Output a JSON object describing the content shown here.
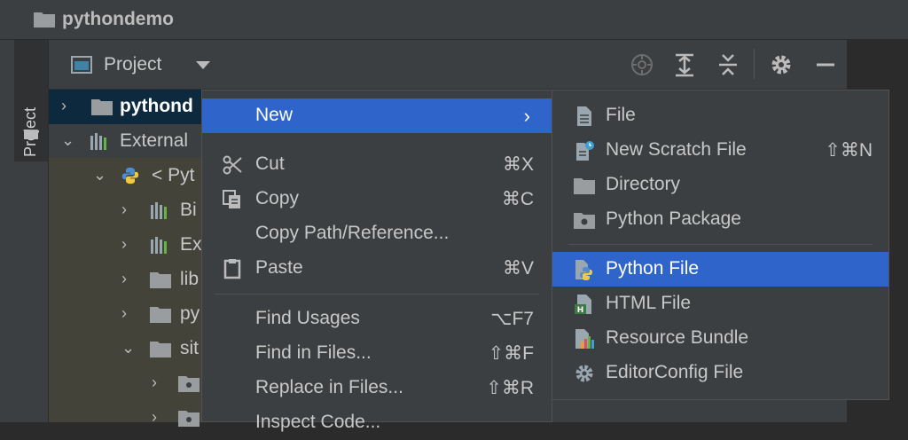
{
  "window": {
    "title": "pythondemo"
  },
  "tool_strip": {
    "tab_label": "Project"
  },
  "project_panel": {
    "view_label": "Project",
    "toolbar_icons": [
      "locate-icon",
      "expand-all-icon",
      "collapse-all-icon",
      "gear-icon",
      "minimize-icon"
    ]
  },
  "tree": {
    "rows": [
      {
        "label": "pythond",
        "arrow": "›",
        "icon": "folder-icon",
        "selected": true,
        "bold": true
      },
      {
        "label": "External",
        "arrow": "⌄",
        "icon": "library-icon"
      },
      {
        "label": "< Pyt",
        "arrow": "⌄",
        "icon": "python-icon"
      },
      {
        "label": "Bi",
        "arrow": "›",
        "icon": "library-icon"
      },
      {
        "label": "Ex",
        "arrow": "›",
        "icon": "library-icon"
      },
      {
        "label": "lib",
        "arrow": "›",
        "icon": "folder-icon"
      },
      {
        "label": "py",
        "arrow": "›",
        "icon": "folder-icon"
      },
      {
        "label": "sit",
        "arrow": "⌄",
        "icon": "folder-icon"
      },
      {
        "label": "",
        "arrow": "›",
        "icon": "package-icon"
      },
      {
        "label": "",
        "arrow": "›",
        "icon": "package-icon"
      }
    ]
  },
  "context_menu": {
    "items": [
      {
        "label": "New",
        "shortcut": "",
        "submenu": "›",
        "icon": "",
        "active": true
      },
      {
        "label": "Cut",
        "shortcut": "⌘X",
        "icon": "scissors-icon"
      },
      {
        "label": "Copy",
        "shortcut": "⌘C",
        "icon": "copy-icon"
      },
      {
        "label": "Copy Path/Reference...",
        "shortcut": "",
        "icon": ""
      },
      {
        "label": "Paste",
        "shortcut": "⌘V",
        "icon": "clipboard-icon"
      },
      {
        "label": "Find Usages",
        "shortcut": "⌥F7",
        "icon": ""
      },
      {
        "label": "Find in Files...",
        "shortcut": "⇧⌘F",
        "icon": ""
      },
      {
        "label": "Replace in Files...",
        "shortcut": "⇧⌘R",
        "icon": ""
      },
      {
        "label": "Inspect Code...",
        "shortcut": "",
        "icon": ""
      }
    ]
  },
  "new_submenu": {
    "items": [
      {
        "label": "File",
        "shortcut": "",
        "icon": "file-icon"
      },
      {
        "label": "New Scratch File",
        "shortcut": "⇧⌘N",
        "icon": "scratch-file-icon"
      },
      {
        "label": "Directory",
        "shortcut": "",
        "icon": "folder-icon"
      },
      {
        "label": "Python Package",
        "shortcut": "",
        "icon": "package-icon"
      },
      {
        "label": "Python File",
        "shortcut": "",
        "icon": "python-file-icon",
        "active": true
      },
      {
        "label": "HTML File",
        "shortcut": "",
        "icon": "html-file-icon"
      },
      {
        "label": "Resource Bundle",
        "shortcut": "",
        "icon": "resource-bundle-icon"
      },
      {
        "label": "EditorConfig File",
        "shortcut": "",
        "icon": "gear-icon"
      }
    ]
  },
  "colors": {
    "selection": "#2f65ca",
    "panel": "#3c3f41",
    "tree_selection": "#0d293e"
  }
}
